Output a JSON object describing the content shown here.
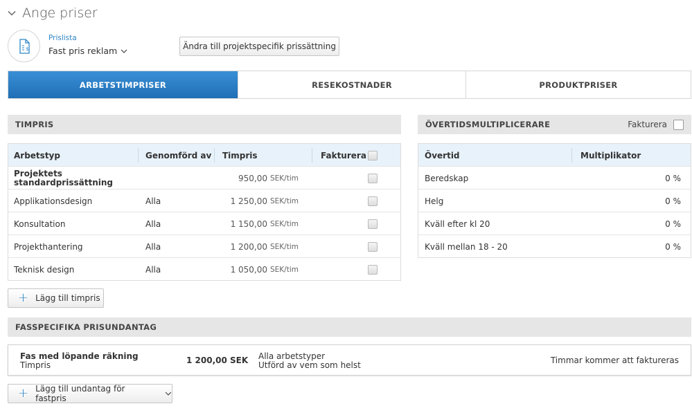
{
  "header": {
    "title": "Ange priser"
  },
  "pricelist": {
    "label": "Prislista",
    "value": "Fast pris reklam",
    "change_button": "Ändra till projektspecifik prissättning"
  },
  "tabs": [
    {
      "label": "ARBETSTIMPRISER",
      "active": true
    },
    {
      "label": "RESEKOSTNADER",
      "active": false
    },
    {
      "label": "PRODUKTPRISER",
      "active": false
    }
  ],
  "hourly": {
    "section_title": "TIMPRIS",
    "columns": {
      "worktype": "Arbetstyp",
      "performed_by": "Genomförd av",
      "rate": "Timpris",
      "invoice": "Fakturera"
    },
    "unit": "SEK/tim",
    "rows": [
      {
        "worktype": "Projektets standardprissättning",
        "performed_by": "",
        "rate": "950,00"
      },
      {
        "worktype": "Applikationsdesign",
        "performed_by": "Alla",
        "rate": "1 250,00"
      },
      {
        "worktype": "Konsultation",
        "performed_by": "Alla",
        "rate": "1 150,00"
      },
      {
        "worktype": "Projekthantering",
        "performed_by": "Alla",
        "rate": "1 200,00"
      },
      {
        "worktype": "Teknisk design",
        "performed_by": "Alla",
        "rate": "1 050,00"
      }
    ],
    "add_button": "Lägg till timpris"
  },
  "overtime": {
    "section_title": "ÖVERTIDSMULTIPLICERARE",
    "invoice_label": "Fakturera",
    "columns": {
      "overtime": "Övertid",
      "multiplier": "Multiplikator"
    },
    "rows": [
      {
        "name": "Beredskap",
        "value": "0 %"
      },
      {
        "name": "Helg",
        "value": "0 %"
      },
      {
        "name": "Kväll efter kl 20",
        "value": "0 %"
      },
      {
        "name": "Kväll mellan 18 - 20",
        "value": "0 %"
      }
    ]
  },
  "phase_exceptions": {
    "section_title": "FASSPECIFIKA PRISUNDANTAG",
    "item": {
      "name": "Fas med löpande räkning",
      "type": "Timpris",
      "amount": "1 200,00 SEK",
      "scope_line1": "Alla arbetstyper",
      "scope_line2": "Utförd av vem som helst",
      "status": "Timmar kommer att faktureras"
    },
    "add_button": "Lägg till undantag för fastpris"
  },
  "colors": {
    "accent": "#2e86c6",
    "tab_active": "#2776bf",
    "section_bg": "#e6e6e6",
    "table_header_bg": "#e8f2fa"
  }
}
